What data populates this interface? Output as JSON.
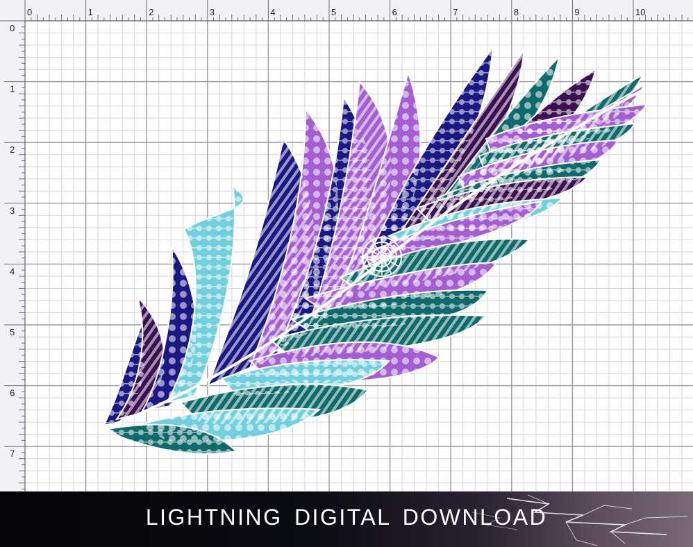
{
  "ruler": {
    "top_labels": [
      "0",
      "1",
      "2",
      "3",
      "4",
      "5",
      "6",
      "7",
      "8",
      "9",
      "10"
    ],
    "left_labels": [
      "0",
      "1",
      "2",
      "3",
      "4",
      "5",
      "6",
      "7"
    ],
    "unit": "inch"
  },
  "artwork": {
    "subject": "mandala feather",
    "colors": {
      "navy": "#1a1883",
      "purple": "#a35ed1",
      "dark_purple": "#3b1052",
      "teal": "#0f6a6c",
      "light_blue": "#72d0dd"
    }
  },
  "banner": {
    "text": "LIGHTNING DIGITAL DOWNLOAD"
  }
}
